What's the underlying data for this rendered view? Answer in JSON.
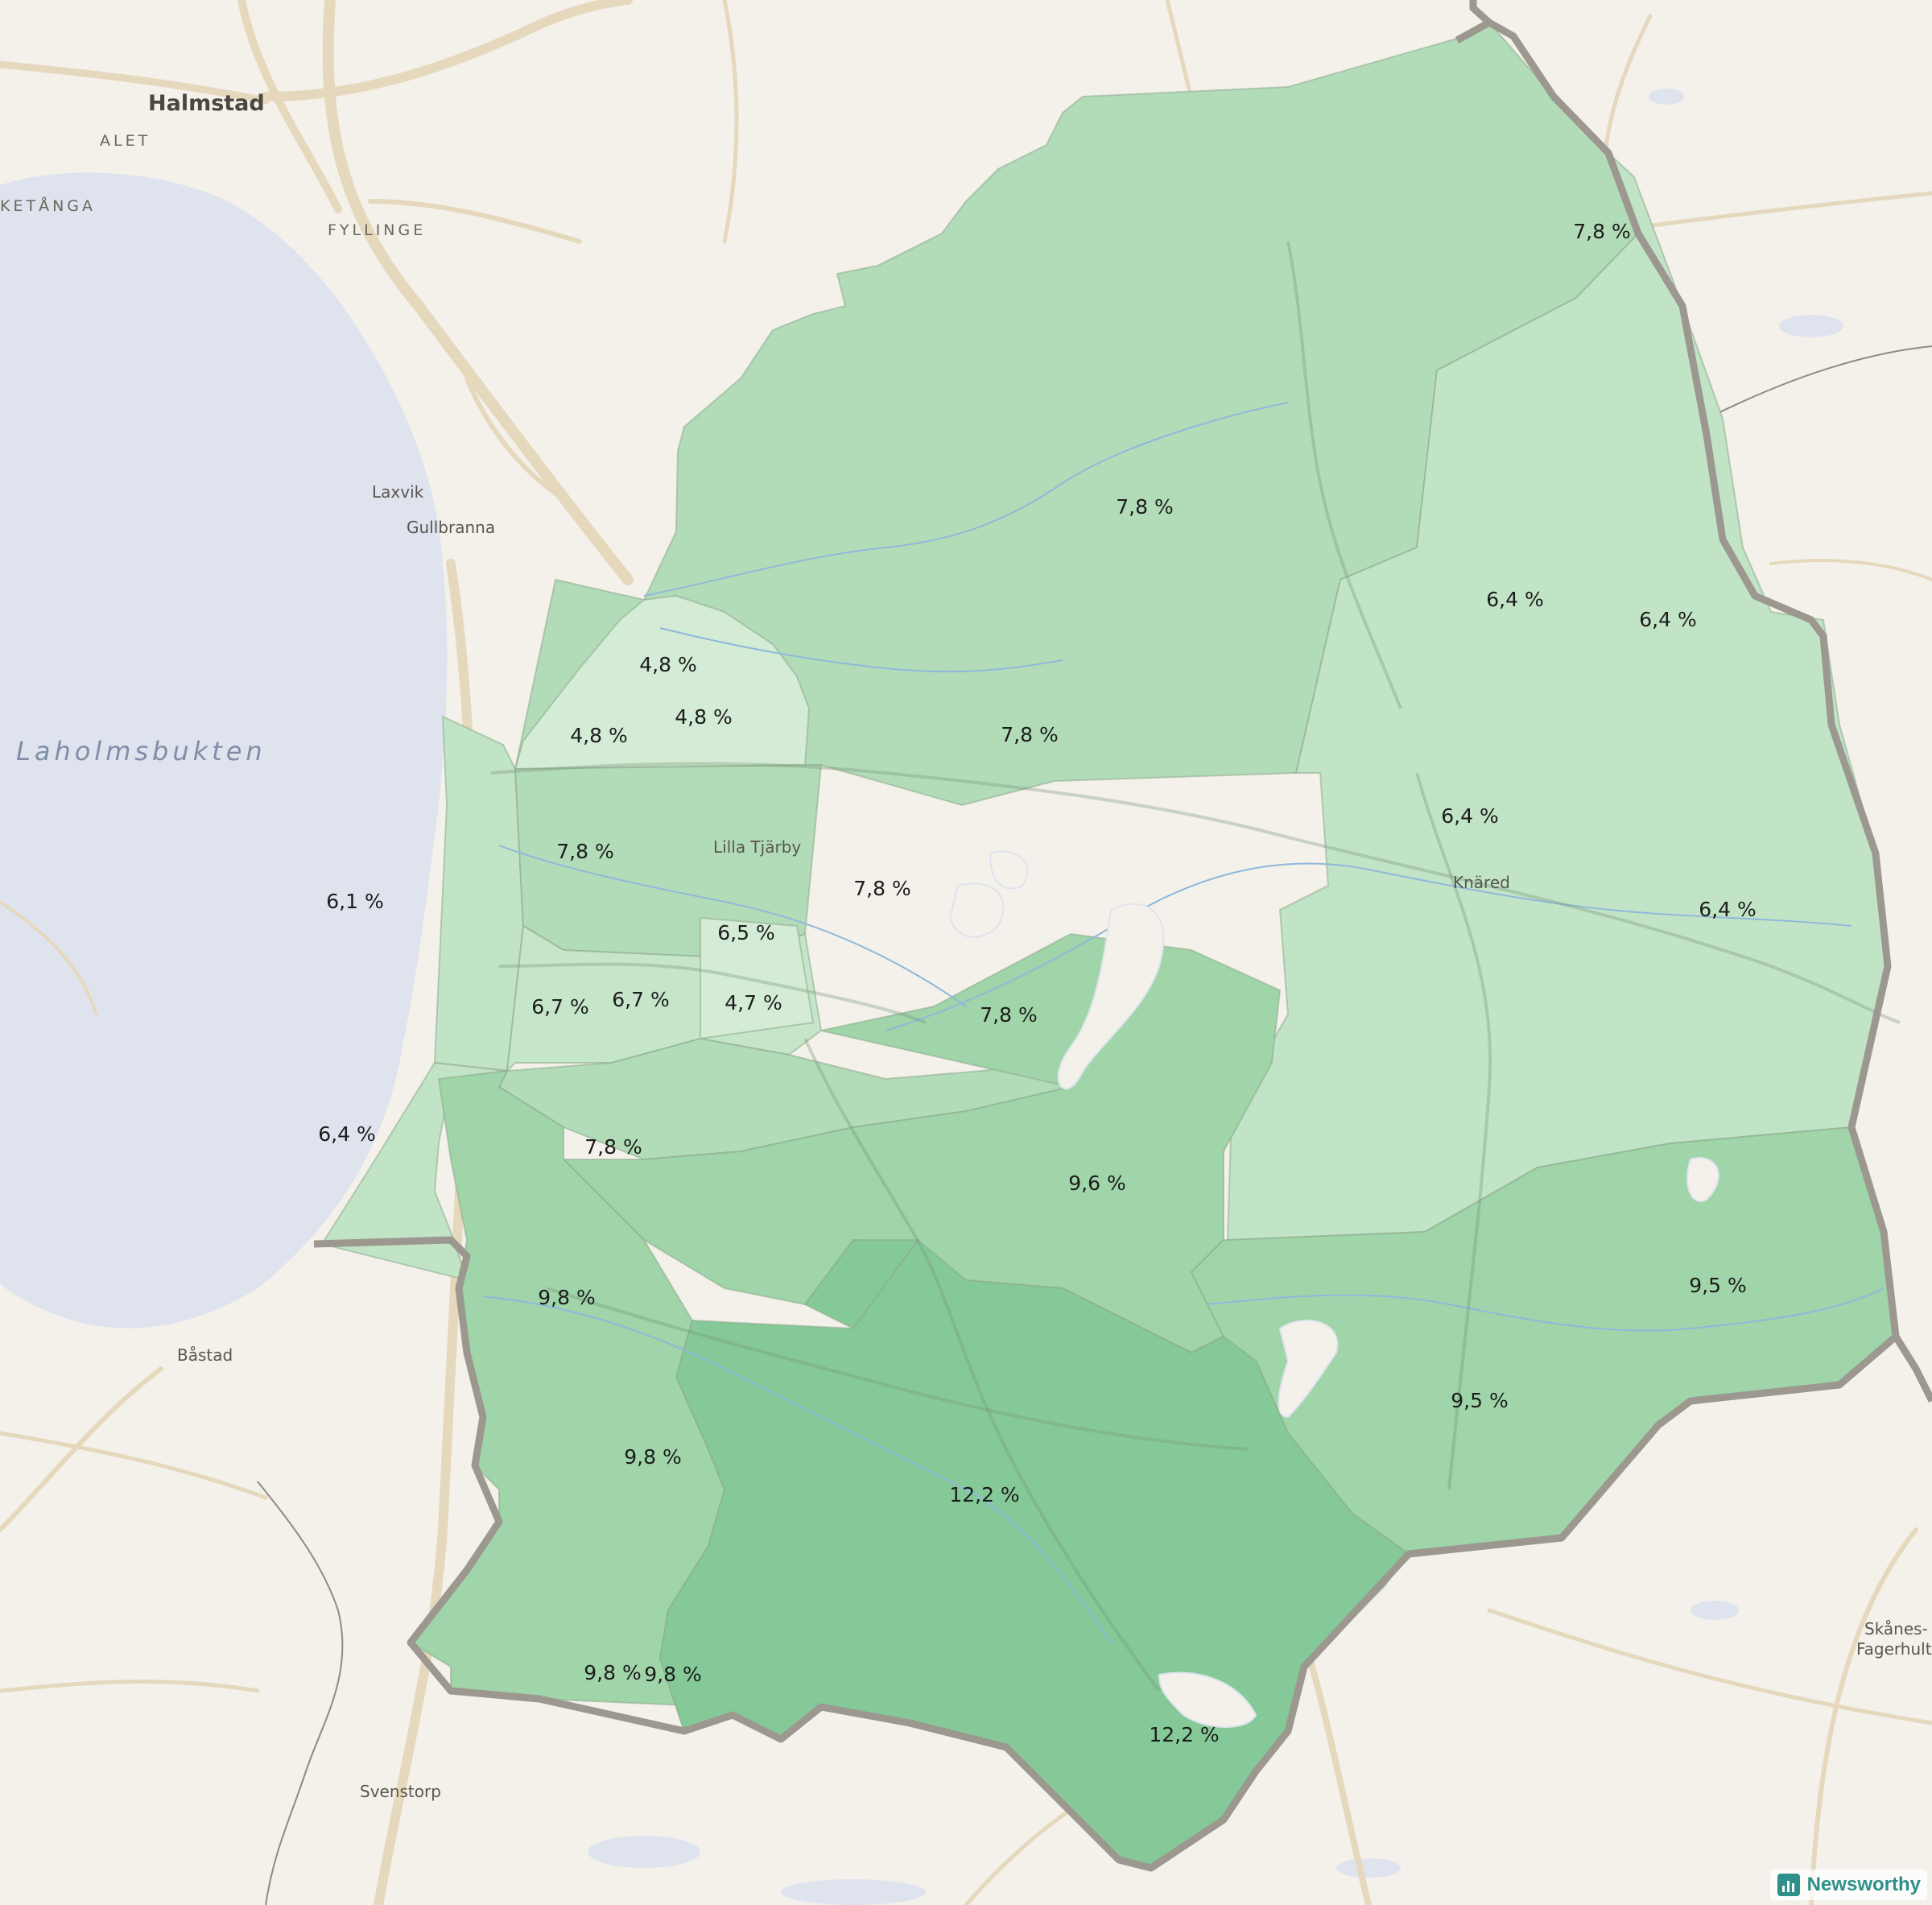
{
  "places": {
    "halmstad": "Halmstad",
    "alet": "ALET",
    "ketanga": "KETÅNGA",
    "fyllinge": "FYLLINGE",
    "laxvik": "Laxvik",
    "gullbranna": "Gullbranna",
    "laholmsbukten": "Laholmsbukten",
    "lilla_tjarby": "Lilla Tjärby",
    "knared": "Knäred",
    "bastad": "Båstad",
    "svenstorp": "Svenstorp",
    "skanes_line1": "Skånes-",
    "skanes_line2": "Fagerhult"
  },
  "regions": [
    {
      "id": "north",
      "label": "7,8 %",
      "value": 7.8
    },
    {
      "id": "north-top",
      "label": "7,8 %",
      "value": 7.8
    },
    {
      "id": "center-north",
      "label": "7,8 %",
      "value": 7.8
    },
    {
      "id": "northeast-a",
      "label": "6,4 %",
      "value": 6.4
    },
    {
      "id": "northeast-b",
      "label": "6,4 %",
      "value": 6.4
    },
    {
      "id": "east-knared",
      "label": "6,4 %",
      "value": 6.4
    },
    {
      "id": "east",
      "label": "6,4 %",
      "value": 6.4
    },
    {
      "id": "nw-a",
      "label": "4,8 %",
      "value": 4.8
    },
    {
      "id": "nw-b",
      "label": "4,8 %",
      "value": 4.8
    },
    {
      "id": "nw-c",
      "label": "4,8 %",
      "value": 4.8
    },
    {
      "id": "west-a",
      "label": "7,8 %",
      "value": 7.8
    },
    {
      "id": "center-a",
      "label": "7,8 %",
      "value": 7.8
    },
    {
      "id": "center-b",
      "label": "7,8 %",
      "value": 7.8
    },
    {
      "id": "coast-north",
      "label": "6,1 %",
      "value": 6.1
    },
    {
      "id": "town-a",
      "label": "6,5 %",
      "value": 6.5
    },
    {
      "id": "town-b",
      "label": "6,7 %",
      "value": 6.7
    },
    {
      "id": "town-c",
      "label": "6,7 %",
      "value": 6.7
    },
    {
      "id": "town-d",
      "label": "4,7 %",
      "value": 4.7
    },
    {
      "id": "coast-south",
      "label": "6,4 %",
      "value": 6.4
    },
    {
      "id": "west-b",
      "label": "7,8 %",
      "value": 7.8
    },
    {
      "id": "center-south",
      "label": "9,6 %",
      "value": 9.6
    },
    {
      "id": "southeast-a",
      "label": "9,5 %",
      "value": 9.5
    },
    {
      "id": "southeast-b",
      "label": "9,5 %",
      "value": 9.5
    },
    {
      "id": "southwest-a",
      "label": "9,8 %",
      "value": 9.8
    },
    {
      "id": "southwest-b",
      "label": "9,8 %",
      "value": 9.8
    },
    {
      "id": "southwest-c",
      "label": "9,8 %",
      "value": 9.8
    },
    {
      "id": "southwest-d",
      "label": "9,8 %",
      "value": 9.8
    },
    {
      "id": "south-a",
      "label": "12,2 %",
      "value": 12.2
    },
    {
      "id": "south-b",
      "label": "12,2 %",
      "value": 12.2
    }
  ],
  "colors": {
    "land": "#f3f1ea",
    "water": "#dfe3ee",
    "road": "#e6d8bd",
    "border": "#9c9890",
    "shade_4": "#d4ecd6",
    "shade_6": "#c2e4c6",
    "shade_7": "#b2dcb8",
    "shade_9": "#9fd5a8",
    "shade_12": "#85c998"
  },
  "credit": {
    "label": "Newsworthy",
    "icon": "bar-chart-icon"
  }
}
